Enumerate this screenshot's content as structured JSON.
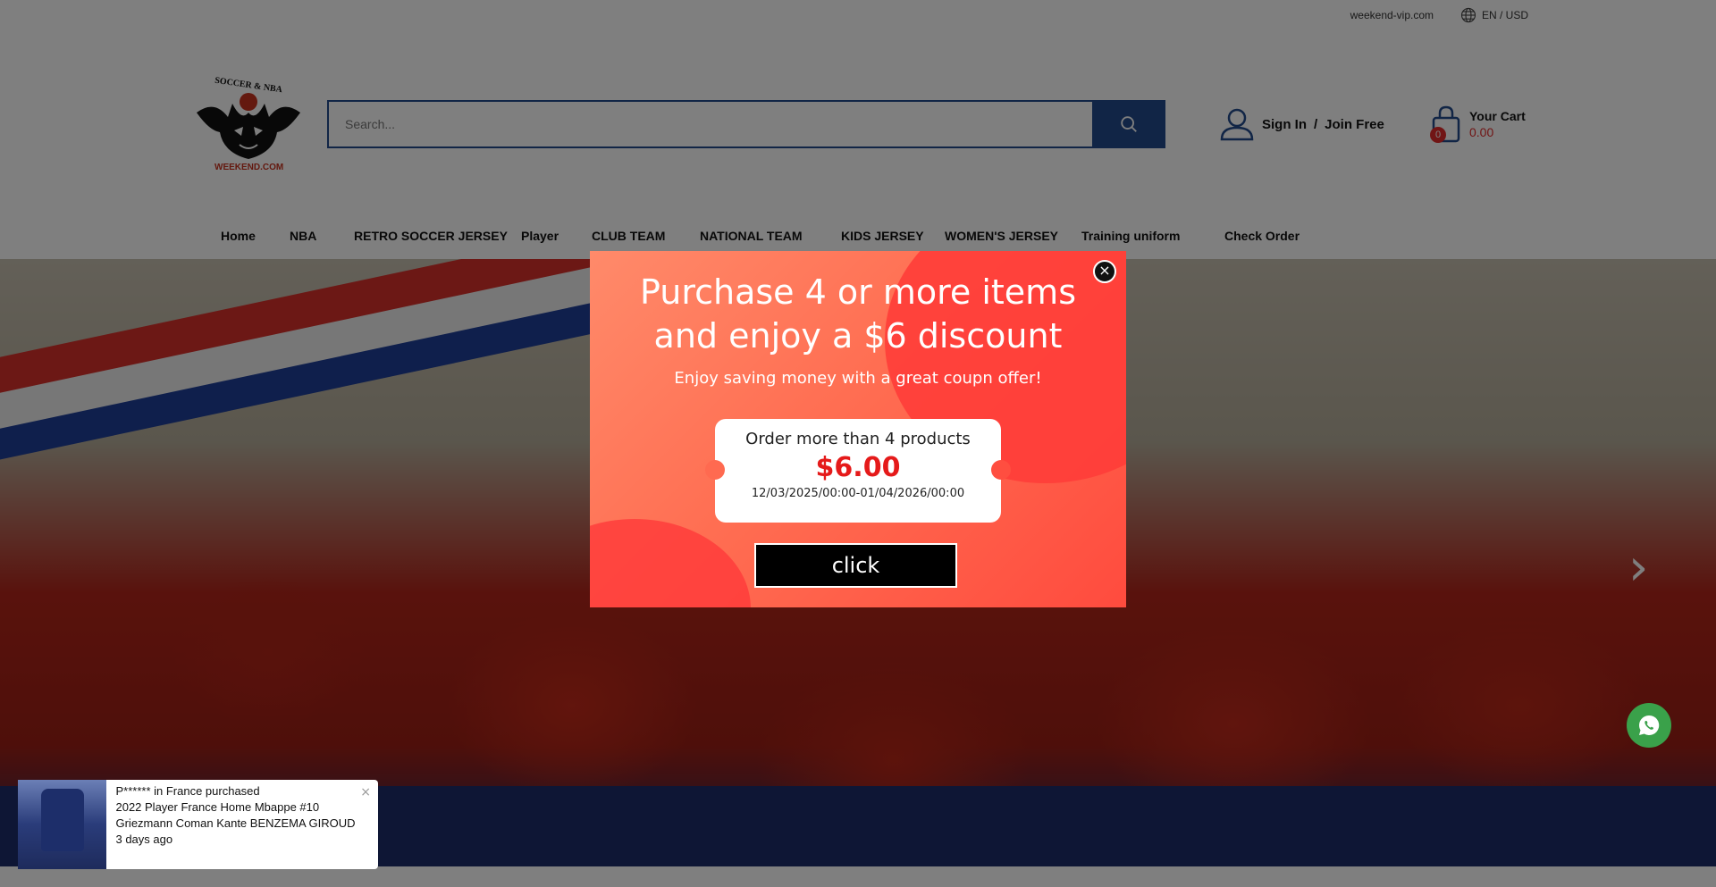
{
  "topbar": {
    "domain": "weekend-vip.com",
    "lang_currency": "EN / USD"
  },
  "logo": {
    "top_text": "SOCCER & NBA",
    "bottom_text": "WEEKEND.COM"
  },
  "search": {
    "placeholder": "Search..."
  },
  "account": {
    "sign_in": "Sign In",
    "separator": "/",
    "join": "Join Free"
  },
  "cart": {
    "title": "Your Cart",
    "total": "0.00",
    "count": "0"
  },
  "nav": {
    "items": [
      {
        "label": "Home"
      },
      {
        "label": "NBA"
      },
      {
        "label": "RETRO SOCCER JERSEY"
      },
      {
        "label": "Player"
      },
      {
        "label": "CLUB TEAM"
      },
      {
        "label": "NATIONAL TEAM"
      },
      {
        "label": "KIDS JERSEY"
      },
      {
        "label": "WOMEN'S JERSEY"
      },
      {
        "label": "Training uniform"
      },
      {
        "label": "Check Order"
      }
    ]
  },
  "popup": {
    "headline": "Purchase 4 or more items and enjoy a $6 discount",
    "subtitle": "Enjoy saving money with a great coupn offer!",
    "coupon": {
      "title": "Order more than 4 products",
      "amount": "$6.00",
      "validity": "12/03/2025/00:00-01/04/2026/00:00"
    },
    "button": "click",
    "close": "×"
  },
  "notification": {
    "line1": "P****** in France purchased",
    "product": "2022 Player France Home Mbappe #10 Griezmann Coman Kante BENZEMA GIROUD",
    "time": "3 days ago",
    "close": "×"
  },
  "colors": {
    "brand_blue": "#234b8c",
    "price_red": "#e22b2b",
    "whatsapp_green": "#3aa14a"
  }
}
